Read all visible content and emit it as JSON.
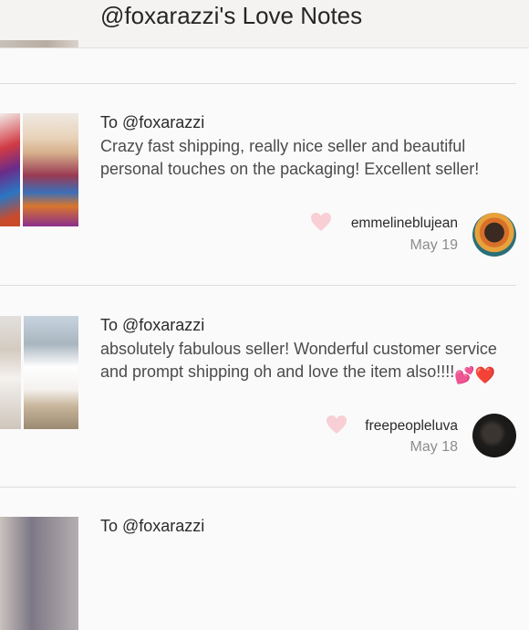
{
  "header": {
    "title": "@foxarazzi's Love Notes"
  },
  "notes": [
    {
      "to": "To @foxarazzi",
      "message": "Crazy fast shipping, really nice seller and beautiful personal touches on the packaging! Excellent seller!",
      "author": "emmelineblujean",
      "date": "May 19"
    },
    {
      "to": "To @foxarazzi",
      "message": "absolutely fabulous seller! Wonderful customer service and prompt shipping oh and love the item also!!!!",
      "emoji": "💕❤️",
      "author": "freepeopleluva",
      "date": "May 18"
    },
    {
      "to": "To @foxarazzi"
    }
  ],
  "colors": {
    "heart": "#f9cfd6",
    "divider": "#dedcdc",
    "date": "#8d8d8d"
  }
}
